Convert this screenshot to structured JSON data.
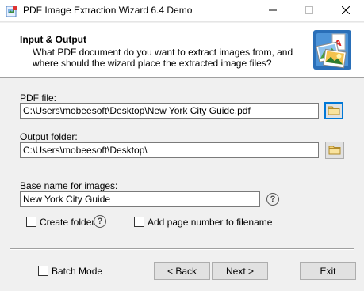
{
  "window": {
    "title": "PDF Image Extraction Wizard 6.4 Demo",
    "min_icon": "minimize-icon",
    "max_icon": "maximize-icon",
    "close_icon": "close-icon"
  },
  "header": {
    "title": "Input & Output",
    "description": "What PDF document do you want to extract images from, and where should the wizard place the extracted image files?",
    "icon": "pdf-images-icon"
  },
  "form": {
    "pdf_file_label": "PDF file:",
    "pdf_file_value": "C:\\Users\\mobeesoft\\Desktop\\New York City Guide.pdf",
    "output_folder_label": "Output folder:",
    "output_folder_value": "C:\\Users\\mobeesoft\\Desktop\\",
    "base_name_label": "Base name for images:",
    "base_name_value": "New York City Guide",
    "create_folder_label": "Create folder",
    "create_folder_checked": false,
    "add_page_number_label": "Add page number to filename",
    "add_page_number_checked": false,
    "help_glyph": "?"
  },
  "footer": {
    "batch_mode_label": "Batch Mode",
    "batch_mode_checked": false,
    "back_label": "< Back",
    "next_label": "Next >",
    "exit_label": "Exit"
  },
  "colors": {
    "accent": "#0078d7",
    "folder": "#f5d27a"
  }
}
